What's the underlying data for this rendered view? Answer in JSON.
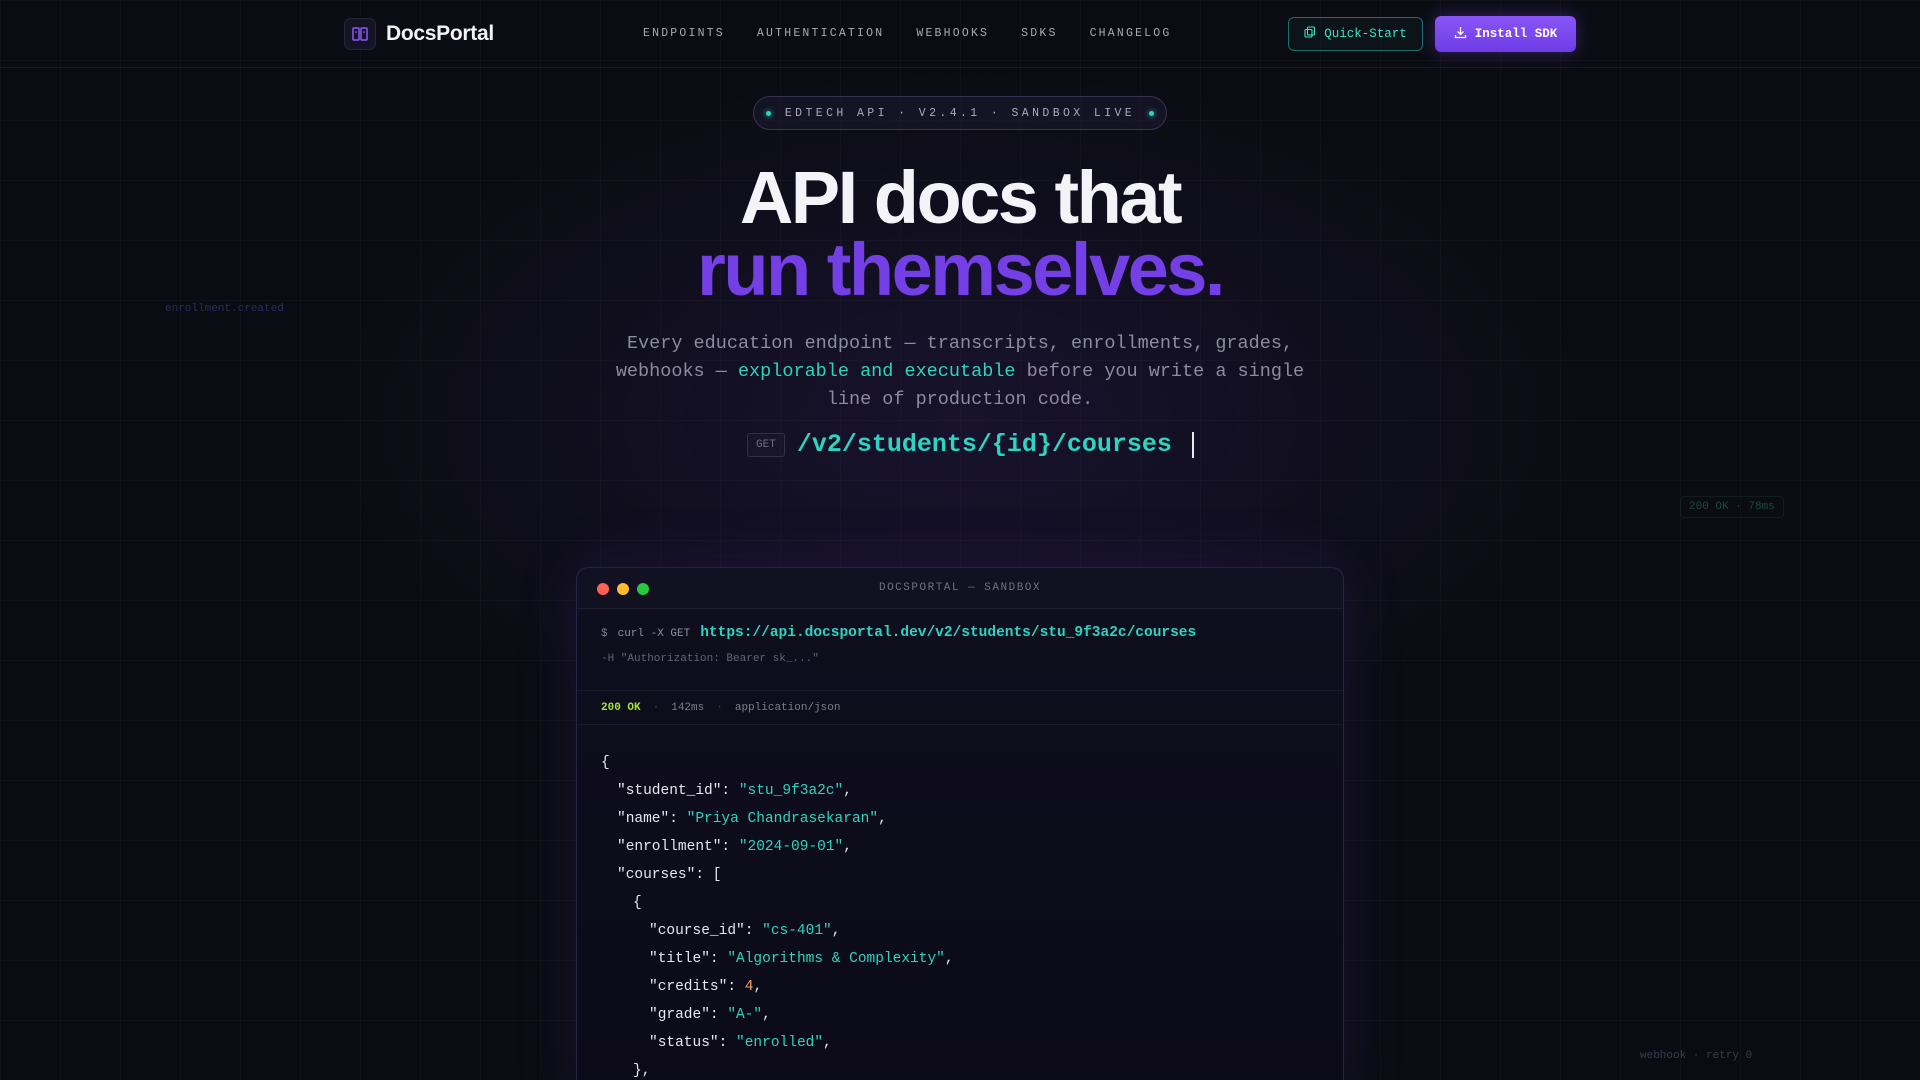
{
  "brand": {
    "name": "DocsPortal"
  },
  "nav": {
    "links": [
      "ENDPOINTS",
      "AUTHENTICATION",
      "WEBHOOKS",
      "SDKS",
      "CHANGELOG"
    ],
    "quick_start_label": "Quick-Start",
    "install_label": "Install SDK"
  },
  "badge": {
    "text": "EDTECH API · V2.4.1 · SANDBOX LIVE"
  },
  "hero": {
    "line1": "API docs that",
    "line2": "run themselves.",
    "sub_before": "Every education endpoint — transcripts, enrollments, grades, webhooks — ",
    "sub_highlight": "explorable and executable",
    "sub_after": " before you write a single line of production code.",
    "endpoint_method": "GET",
    "endpoint_path": "/v2/students/{id}/courses"
  },
  "floating": {
    "left_label": "enrollment.created",
    "right_label": "200 OK · 78ms",
    "bottom_label": "webhook · retry 0"
  },
  "terminal": {
    "title": "DOCSPORTAL — SANDBOX",
    "prompt": "$",
    "verb": "curl -X GET",
    "url": "https://api.docsportal.dev/v2/students/stu_9f3a2c/courses",
    "header": "-H \"Authorization: Bearer sk_...\"",
    "status_code": "200 OK",
    "latency": "142ms",
    "content_type": "application/json",
    "json_lines": [
      {
        "indent": 0,
        "parts": [
          [
            "p",
            "{"
          ]
        ]
      },
      {
        "indent": 1,
        "parts": [
          [
            "k",
            "\"student_id\""
          ],
          [
            "p",
            ": "
          ],
          [
            "s",
            "\"stu_9f3a2c\""
          ],
          [
            "p",
            ","
          ]
        ]
      },
      {
        "indent": 1,
        "parts": [
          [
            "k",
            "\"name\""
          ],
          [
            "p",
            ": "
          ],
          [
            "s",
            "\"Priya Chandrasekaran\""
          ],
          [
            "p",
            ","
          ]
        ]
      },
      {
        "indent": 1,
        "parts": [
          [
            "k",
            "\"enrollment\""
          ],
          [
            "p",
            ": "
          ],
          [
            "s",
            "\"2024-09-01\""
          ],
          [
            "p",
            ","
          ]
        ]
      },
      {
        "indent": 1,
        "parts": [
          [
            "k",
            "\"courses\""
          ],
          [
            "p",
            ": ["
          ]
        ]
      },
      {
        "indent": 2,
        "parts": [
          [
            "p",
            "{"
          ]
        ]
      },
      {
        "indent": 3,
        "parts": [
          [
            "k",
            "\"course_id\""
          ],
          [
            "p",
            ": "
          ],
          [
            "s",
            "\"cs-401\""
          ],
          [
            "p",
            ","
          ]
        ]
      },
      {
        "indent": 3,
        "parts": [
          [
            "k",
            "\"title\""
          ],
          [
            "p",
            ": "
          ],
          [
            "s",
            "\"Algorithms & Complexity\""
          ],
          [
            "p",
            ","
          ]
        ]
      },
      {
        "indent": 3,
        "parts": [
          [
            "k",
            "\"credits\""
          ],
          [
            "p",
            ": "
          ],
          [
            "n",
            "4"
          ],
          [
            "p",
            ","
          ]
        ]
      },
      {
        "indent": 3,
        "parts": [
          [
            "k",
            "\"grade\""
          ],
          [
            "p",
            ": "
          ],
          [
            "s",
            "\"A-\""
          ],
          [
            "p",
            ","
          ]
        ]
      },
      {
        "indent": 3,
        "parts": [
          [
            "k",
            "\"status\""
          ],
          [
            "p",
            ": "
          ],
          [
            "s",
            "\"enrolled\""
          ],
          [
            "p",
            ","
          ]
        ]
      },
      {
        "indent": 2,
        "parts": [
          [
            "p",
            "},"
          ]
        ]
      }
    ]
  },
  "colors": {
    "accent_teal": "#2dd4bf",
    "accent_purple": "#7440e6",
    "status_ok": "#a3e635"
  },
  "icons": {
    "brand": "book-icon",
    "quick_start": "copy-icon",
    "install": "download-icon"
  }
}
